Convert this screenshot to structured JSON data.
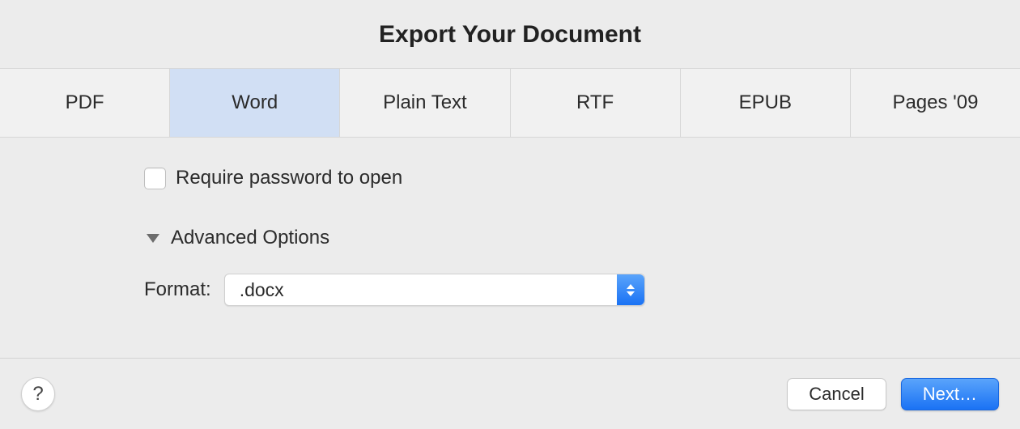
{
  "title": "Export Your Document",
  "tabs": [
    {
      "label": "PDF",
      "selected": false
    },
    {
      "label": "Word",
      "selected": true
    },
    {
      "label": "Plain Text",
      "selected": false
    },
    {
      "label": "RTF",
      "selected": false
    },
    {
      "label": "EPUB",
      "selected": false
    },
    {
      "label": "Pages '09",
      "selected": false
    }
  ],
  "options": {
    "require_password_label": "Require password to open",
    "require_password_checked": false,
    "advanced_label": "Advanced Options",
    "advanced_expanded": true,
    "format_label": "Format:",
    "format_value": ".docx"
  },
  "footer": {
    "help_label": "?",
    "cancel_label": "Cancel",
    "next_label": "Next…"
  }
}
